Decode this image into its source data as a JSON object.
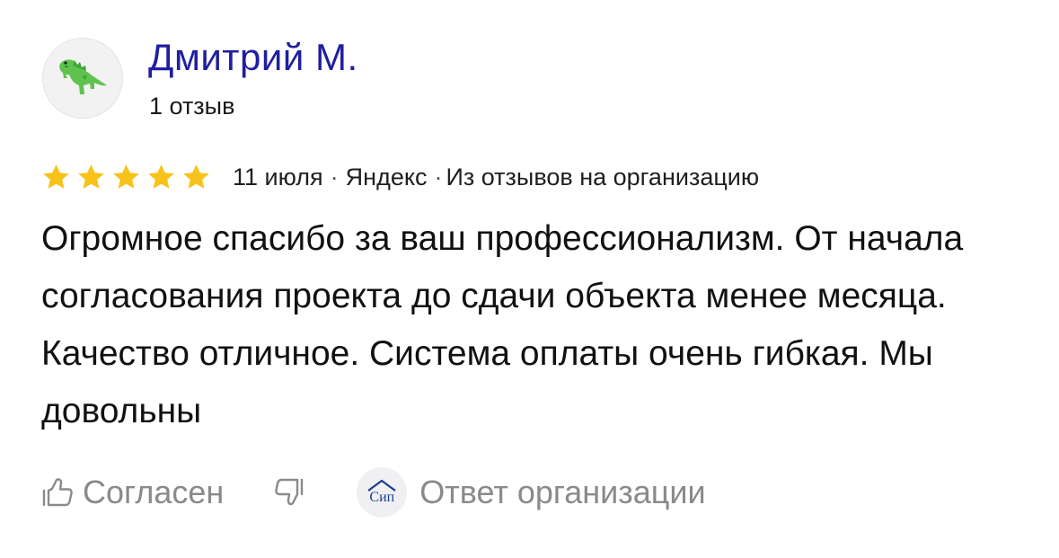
{
  "author": {
    "name": "Дмитрий М.",
    "reviews_count": "1 отзыв",
    "avatar_icon": "dinosaur-icon"
  },
  "rating": {
    "value": 5,
    "max": 5,
    "color": "#f7c31a"
  },
  "meta": {
    "date": "11 июля",
    "separator": "·",
    "source": "Яндекс",
    "origin": "Из отзывов на организацию"
  },
  "review": {
    "text": "Огромное спасибо за ваш профессионализм. От начала согласования проекта до сдачи объекта менее месяца. Качество отличное. Система оплаты очень гибкая. Мы довольны"
  },
  "actions": {
    "like_label": "Согласен",
    "like_icon": "thumbs-up-icon",
    "dislike_icon": "thumbs-down-icon",
    "org_badge_text": "Сип",
    "org_reply_label": "Ответ организации"
  }
}
